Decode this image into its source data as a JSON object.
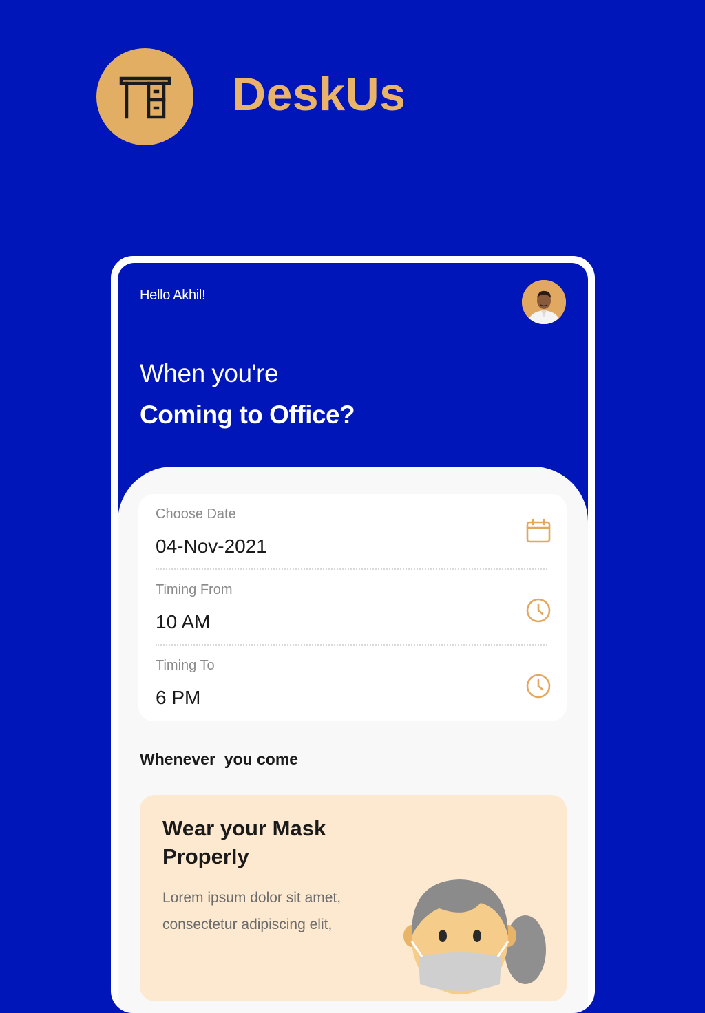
{
  "brand": {
    "name": "DeskUs",
    "logo_icon": "desk-icon",
    "accent": "#e2ae64"
  },
  "header": {
    "greeting": "Hello Akhil!",
    "avatar_icon": "user-avatar",
    "headline_line1": "When you're",
    "headline_line2": "Coming to Office?"
  },
  "booking_form": {
    "fields": [
      {
        "label": "Choose Date",
        "value": "04-Nov-2021",
        "icon": "calendar-icon"
      },
      {
        "label": "Timing From",
        "value": "10 AM",
        "icon": "clock-icon"
      },
      {
        "label": "Timing To",
        "value": "6 PM",
        "icon": "clock-icon"
      }
    ]
  },
  "section": {
    "title": "Whenever  you come"
  },
  "tip_card": {
    "title": "Wear your Mask Properly",
    "body": "Lorem ipsum dolor sit amet, consectetur adipiscing elit,",
    "illustration": "masked-person-illustration"
  },
  "colors": {
    "primary": "#0016b8",
    "accent": "#e2ae64",
    "card_tint": "#fde9cf"
  }
}
